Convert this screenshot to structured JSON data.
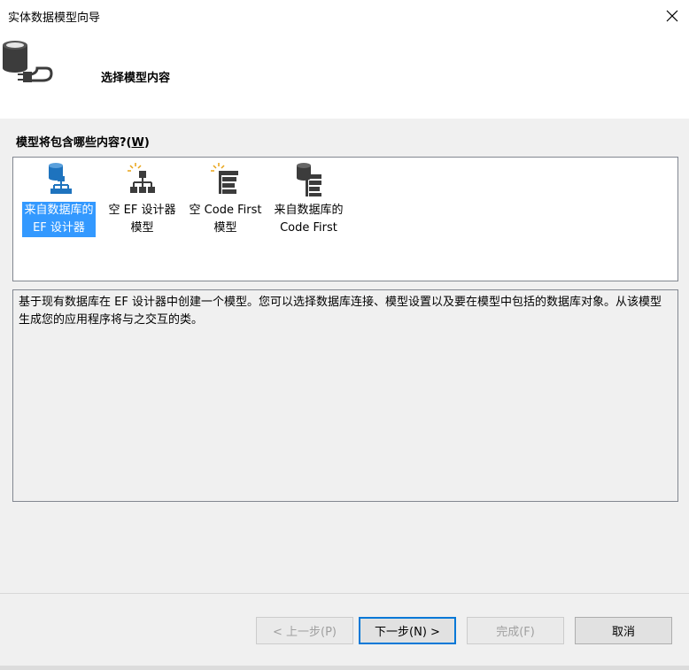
{
  "window": {
    "title": "实体数据模型向导",
    "close_icon": "close-icon"
  },
  "header": {
    "icon": "database-plug-icon",
    "page_title": "选择模型内容"
  },
  "prompt": {
    "label": "模型将包含哪些内容?(",
    "mnemonic": "W",
    "close": ")"
  },
  "model_types": [
    {
      "label": "来自数据库的\nEF 设计器",
      "icon": "database-hierarchy-icon",
      "selected": true
    },
    {
      "label": "空 EF 设计器\n模型",
      "icon": "empty-hierarchy-icon",
      "selected": false
    },
    {
      "label": "空 Code First\n模型",
      "icon": "empty-code-first-icon",
      "selected": false
    },
    {
      "label": "来自数据库的\nCode First",
      "icon": "database-code-first-icon",
      "selected": false
    }
  ],
  "description": "基于现有数据库在 EF 设计器中创建一个模型。您可以选择数据库连接、模型设置以及要在模型中包括的数据库对象。从该模型生成您的应用程序将与之交互的类。",
  "buttons": {
    "previous": "< 上一步(P)",
    "next": "下一步(N) >",
    "finish": "完成(F)",
    "cancel": "取消"
  },
  "colors": {
    "selection": "#3399ff",
    "accent": "#0078d7",
    "icon_blue": "#1e73be",
    "icon_dark": "#3c3c3c",
    "icon_orange": "#e8a317"
  }
}
